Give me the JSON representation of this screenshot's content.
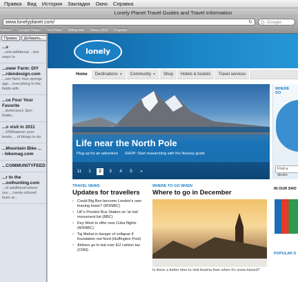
{
  "menubar": {
    "items": [
      "Правка",
      "Вид",
      "История",
      "Закладки",
      "Окно",
      "Справка"
    ]
  },
  "window": {
    "title": "Lonely Planet Travel Guides and Travel Information"
  },
  "toolbar": {
    "url": "www.lonelyplanet.com/",
    "reload_icon": "reload-icon",
    "search_placeholder": "Q- Google"
  },
  "bookmarks": {
    "items": [
      "Yahoo!",
      "Google Maps",
      "YouTube",
      "Wikipedia",
      "News (84)",
      "Popular"
    ]
  },
  "sidebar": {
    "buttons": [
      "Правка",
      "Добавить..."
    ],
    "items": [
      {
        "title": "...s",
        "desc": "...and additional\n...tive ways to"
      },
      {
        "title": "...ower Farm: DIY\n...rdendesign.com",
        "desc": "...wer farm; four springs ago\n...everything to the fields with"
      },
      {
        "title": "...ce Four Your Favorite",
        "desc": "...dominance 3pm Rattle..."
      },
      {
        "title": "...o visit in 2011",
        "desc": "...10Whatever your levels,\n...of things to do"
      },
      {
        "title": "...Mountain Bike\n... - bikemag.com",
        "desc": ""
      },
      {
        "title": "...COMMUNITYFEED",
        "desc": ""
      },
      {
        "title": "...r to the\n...oolhunting.com",
        "desc": "...of adulthood where you\n...candy-colored hues ar..."
      }
    ]
  },
  "site": {
    "logo_text": "lonely planet",
    "nav": [
      {
        "label": "Home",
        "active": true,
        "dropdown": false
      },
      {
        "label": "Destinations",
        "active": false,
        "dropdown": true
      },
      {
        "label": "Community",
        "active": false,
        "dropdown": true
      },
      {
        "label": "Shop",
        "active": false,
        "dropdown": false
      },
      {
        "label": "Hotels & hostels",
        "active": false,
        "dropdown": false
      },
      {
        "label": "Travel services",
        "active": false,
        "dropdown": false
      }
    ],
    "hero": {
      "title": "Life near the North Pole",
      "links": [
        "Plug up for an adventure",
        "SHOP: Start researching with the Norway guide"
      ],
      "pages": [
        "11",
        "1",
        "2",
        "3",
        "4",
        "5"
      ],
      "active_page": "2",
      "next_icon": "next-arrow-icon"
    },
    "where_panel": {
      "label": "WHERE DO",
      "find": "Find a destin"
    },
    "news": {
      "kicker": "TRAVEL NEWS",
      "title": "Updates for travellers",
      "items": [
        "Could Big Ben become London's own leaning tower? (MSNBC)",
        "UK's Preston Bus Station on 'at risk' monument list (BBC)",
        "Key West to offer new Cuba flights (MSNBC)",
        "Taj Mahal in danger of collapse if foundation not fixed (Huffington Post)",
        "Airlines go to bat over EU carbon tax (CNN)"
      ]
    },
    "where_to_go": {
      "kicker": "WHERE TO GO WHEN",
      "title": "Where to go in December",
      "caption": "Is there a better time to visit Austria than when it's snow-kissed?"
    },
    "shop": {
      "label": "IN OUR SHO",
      "popular": "POPULAR D"
    }
  },
  "colors": {
    "brand_blue": "#1b86c8",
    "link_red": "#e2312a",
    "accent_blue": "#1f7fc6"
  }
}
